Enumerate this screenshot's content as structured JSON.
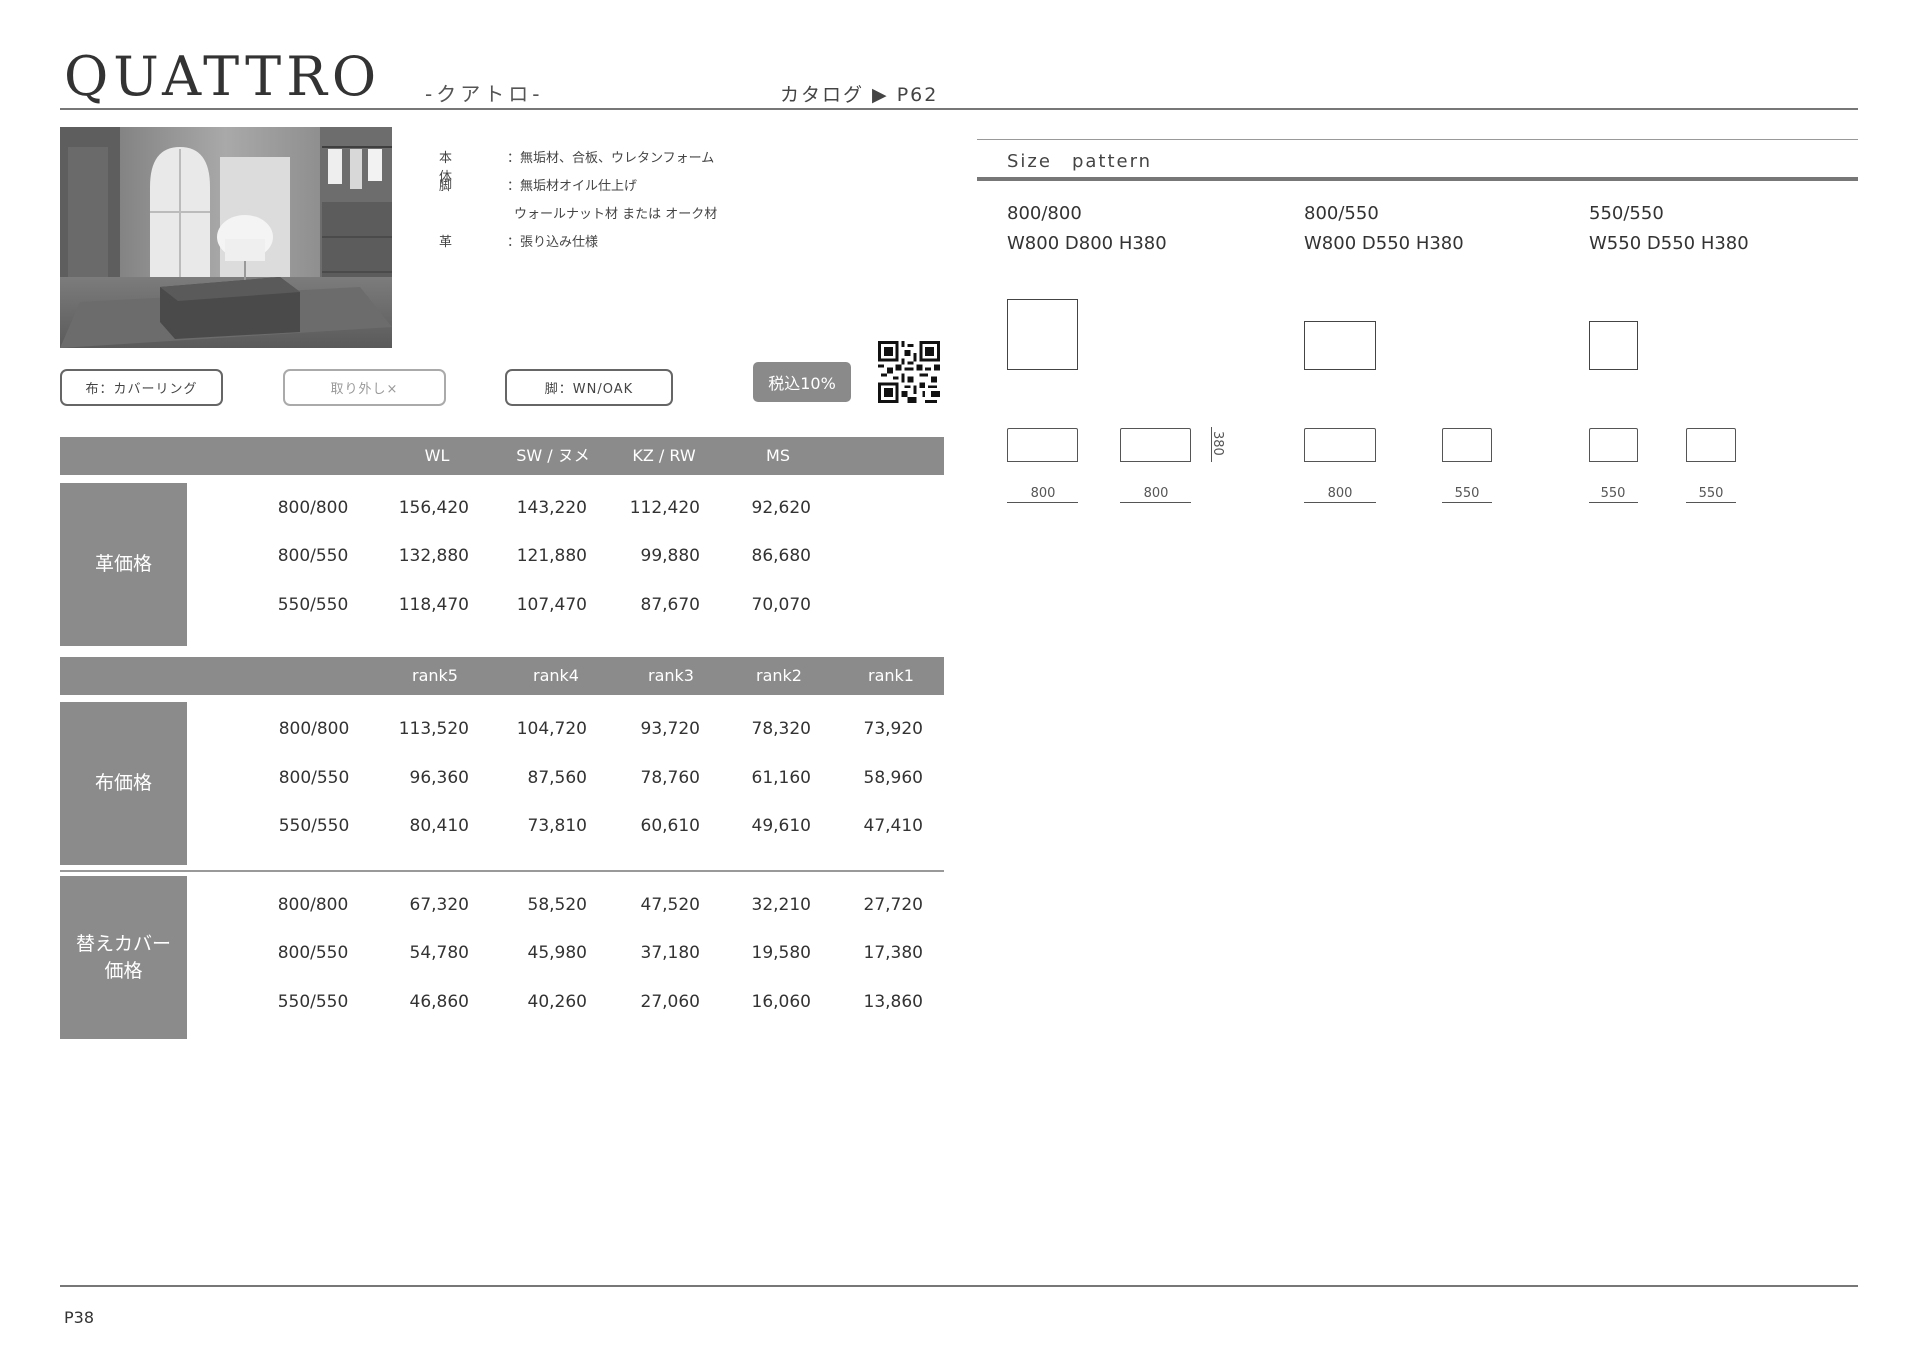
{
  "header": {
    "title": "QUATTRO",
    "kana": "-クアトロ-",
    "catalog_ref": "カタログ ▶ P62"
  },
  "spec": [
    {
      "label": "本体",
      "value": "：無垢材、合板、ウレタンフォーム"
    },
    {
      "label": "脚",
      "value": "：無垢材オイル仕上げ"
    },
    {
      "label": "",
      "value": "ウォールナット材 または オーク材"
    },
    {
      "label": "革",
      "value": "：張り込み仕様"
    }
  ],
  "options": {
    "fabric": "布：カバーリング",
    "removable": "取り外し×",
    "legs": "脚：WN/OAK",
    "tax": "税込10%"
  },
  "leather_table": {
    "side_label": "革価格",
    "headers": [
      "WL",
      "SW / ヌメ",
      "KZ / RW",
      "MS"
    ],
    "rows": [
      {
        "size": "800/800",
        "v1": "156,420",
        "v2": "143,220",
        "v3": "112,420",
        "v4": "92,620"
      },
      {
        "size": "800/550",
        "v1": "132,880",
        "v2": "121,880",
        "v3": "99,880",
        "v4": "86,680"
      },
      {
        "size": "550/550",
        "v1": "118,470",
        "v2": "107,470",
        "v3": "87,670",
        "v4": "70,070"
      }
    ]
  },
  "fabric_table": {
    "side_label": "布価格",
    "headers": [
      "rank5",
      "rank4",
      "rank3",
      "rank2",
      "rank1"
    ],
    "rows": [
      {
        "size": "800/800",
        "v1": "113,520",
        "v2": "104,720",
        "v3": "93,720",
        "v4": "78,320",
        "v5": "73,920"
      },
      {
        "size": "800/550",
        "v1": "96,360",
        "v2": "87,560",
        "v3": "78,760",
        "v4": "61,160",
        "v5": "58,960"
      },
      {
        "size": "550/550",
        "v1": "80,410",
        "v2": "73,810",
        "v3": "60,610",
        "v4": "49,610",
        "v5": "47,410"
      }
    ]
  },
  "cover_table": {
    "side_label_1": "替えカバー",
    "side_label_2": "価格",
    "rows": [
      {
        "size": "800/800",
        "v1": "67,320",
        "v2": "58,520",
        "v3": "47,520",
        "v4": "32,210",
        "v5": "27,720"
      },
      {
        "size": "800/550",
        "v1": "54,780",
        "v2": "45,980",
        "v3": "37,180",
        "v4": "19,580",
        "v5": "17,380"
      },
      {
        "size": "550/550",
        "v1": "46,860",
        "v2": "40,260",
        "v3": "27,060",
        "v4": "16,060",
        "v5": "13,860"
      }
    ]
  },
  "size_pattern": {
    "heading": "Size　pattern",
    "height_label": "380",
    "patterns": [
      {
        "name": "800/800",
        "dims": "W800 D800 H380",
        "front": "800",
        "side": "800"
      },
      {
        "name": "800/550",
        "dims": "W800 D550 H380",
        "front": "800",
        "side": "550"
      },
      {
        "name": "550/550",
        "dims": "W550 D550 H380",
        "front": "550",
        "side": "550"
      }
    ]
  },
  "footer": {
    "page": "P38"
  }
}
